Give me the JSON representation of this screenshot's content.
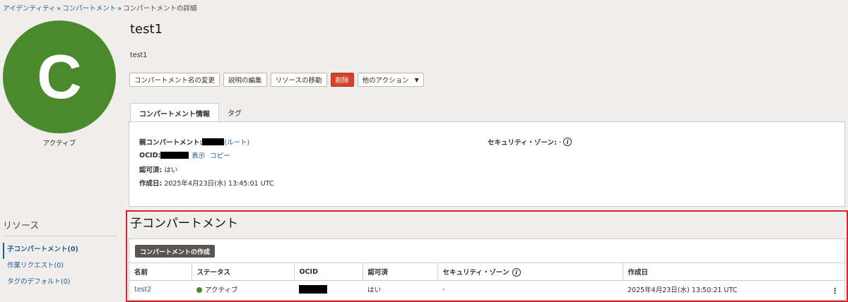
{
  "breadcrumb": {
    "items": [
      "アイデンティティ",
      "コンパートメント"
    ],
    "separator": "»",
    "current": "コンパートメントの詳細"
  },
  "avatar": {
    "letter": "C",
    "status": "アクティブ",
    "color": "#4b8a2c"
  },
  "resources": {
    "title": "リソース",
    "items": [
      {
        "label": "子コンパートメント(0)",
        "active": true
      },
      {
        "label": "作業リクエスト(0)",
        "active": false
      },
      {
        "label": "タグのデフォルト(0)",
        "active": false
      }
    ]
  },
  "compartment": {
    "name": "test1",
    "description": "test1"
  },
  "actions": {
    "rename": "コンパートメント名の変更",
    "edit_description": "説明の編集",
    "move_resource": "リソースの移動",
    "delete": "削除",
    "more_actions": "他のアクション"
  },
  "tabs": [
    "コンパートメント情報",
    "タグ"
  ],
  "info": {
    "parent_label": "親コンパートメント:",
    "parent_root": "(ルート)",
    "ocid_label": "OCID:",
    "ocid_show": "表示",
    "ocid_copy": "コピー",
    "authorized_label": "認可済:",
    "authorized_value": "はい",
    "created_label": "作成日:",
    "created_value": "2025年4月23日(水) 13:45:01 UTC",
    "security_zone_label": "セキュリティ・ゾーン:",
    "security_zone_value": "-"
  },
  "child": {
    "title": "子コンパートメント",
    "create_button": "コンパートメントの作成",
    "columns": [
      "名前",
      "ステータス",
      "OCID",
      "認可済",
      "セキュリティ・ゾーン",
      "作成日"
    ],
    "rows": [
      {
        "name": "test2",
        "status": "アクティブ",
        "authorized": "はい",
        "security_zone": "-",
        "created": "2025年4月23日(水) 13:50:21 UTC"
      }
    ]
  },
  "colors": {
    "accent": "#1f5c8f",
    "danger": "#d1432b",
    "active": "#4b8a2c",
    "highlight": "#d8212f"
  }
}
